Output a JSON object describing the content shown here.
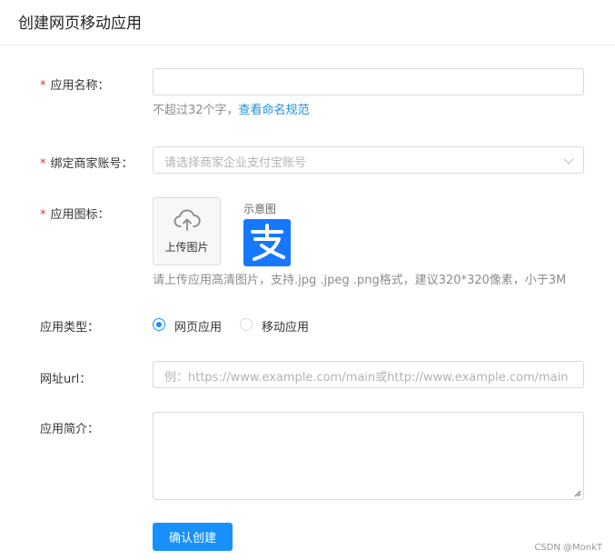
{
  "header": {
    "title": "创建网页移动应用"
  },
  "form": {
    "required_mark": "*",
    "app_name": {
      "label": "应用名称：",
      "value": "",
      "hint_prefix": "不超过32个字，",
      "hint_link": "查看命名规范"
    },
    "merchant_account": {
      "label": "绑定商家账号：",
      "placeholder": "请选择商家企业支付宝账号"
    },
    "app_icon": {
      "label": "应用图标：",
      "upload_label": "上传图片",
      "sample_label": "示意图",
      "hint": "请上传应用高清图片，支持.jpg .jpeg .png格式，建议320*320像素，小于3M"
    },
    "app_type": {
      "label": "应用类型：",
      "options": [
        "网页应用",
        "移动应用"
      ],
      "selected": "网页应用"
    },
    "website_url": {
      "label": "网址url：",
      "placeholder": "例：https://www.example.com/main或http://www.example.com/main"
    },
    "app_intro": {
      "label": "应用简介：",
      "value": ""
    },
    "submit_label": "确认创建"
  },
  "watermark": "CSDN @MonkT",
  "colors": {
    "primary": "#1890ff",
    "link": "#1f8fe0",
    "required": "#e0312f",
    "alipay_blue": "#1678ff"
  },
  "icons": {
    "upload": "cloud-upload-icon",
    "dropdown": "chevron-down-icon",
    "logo": "alipay-logo"
  }
}
